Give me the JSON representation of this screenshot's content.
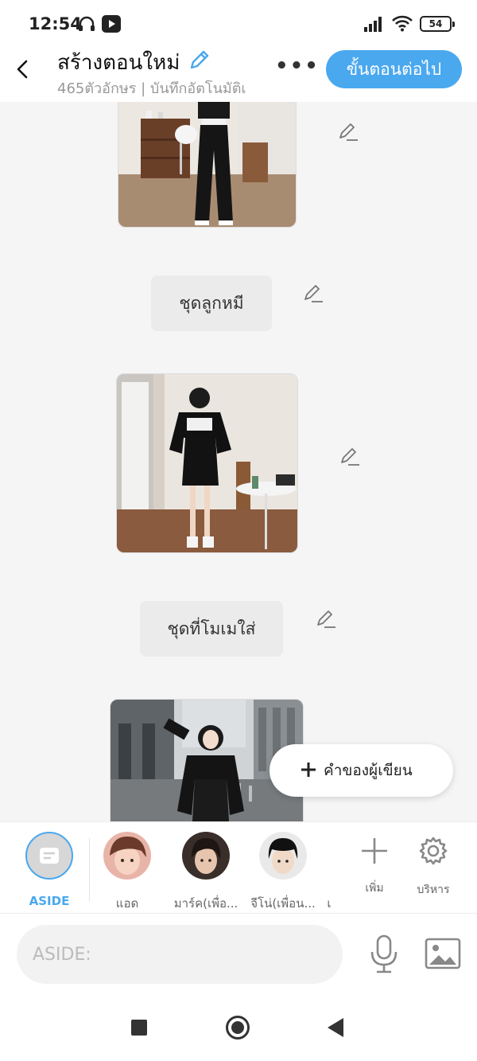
{
  "status_bar": {
    "time": "12:54",
    "battery": "54"
  },
  "header": {
    "title": "สร้างตอนใหม่",
    "subtitle": "465ตัวอักษร | บันทึกอัตโนมัติเ",
    "next_button": "ขั้นตอนต่อไป"
  },
  "story": {
    "captions": [
      "ชุดลูกหมี",
      "ชุดที่โมเมใส่"
    ]
  },
  "fab": {
    "label": "คำของผู้เขียน"
  },
  "characters": [
    {
      "label": "ASIDE"
    },
    {
      "label": "แอด"
    },
    {
      "label": "มาร์ค(เพื่อ..."
    },
    {
      "label": "จีโน่(เพื่อน..."
    },
    {
      "label": "เ"
    }
  ],
  "tools": {
    "add_label": "เพิ่ม",
    "manage_label": "บริหาร"
  },
  "input": {
    "placeholder": "ASIDE:"
  },
  "colors": {
    "accent": "#4aa8ee",
    "background": "#f5f5f5"
  }
}
